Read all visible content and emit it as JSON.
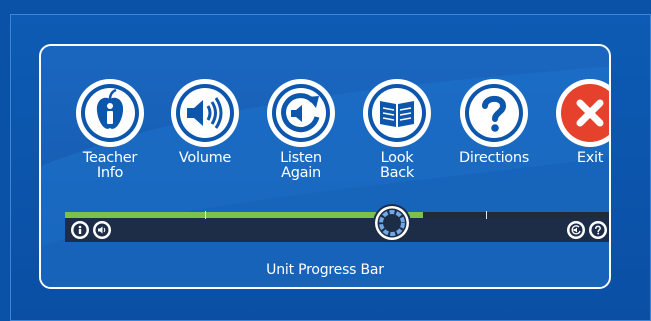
{
  "toolbar": {
    "buttons": [
      {
        "label": "Teacher\nInfo",
        "icon": "teacher-info-icon"
      },
      {
        "label": "Volume",
        "icon": "volume-icon"
      },
      {
        "label": "Listen\nAgain",
        "icon": "listen-again-icon"
      },
      {
        "label": "Look\nBack",
        "icon": "look-back-icon"
      },
      {
        "label": "Directions",
        "icon": "directions-icon"
      },
      {
        "label": "Exit",
        "icon": "exit-icon"
      }
    ]
  },
  "progress_bar": {
    "label": "Unit Progress Bar",
    "progress_fraction": 0.635,
    "tick_marks": 2
  },
  "colors": {
    "background": "#0a52a8",
    "panel": "#1a66bf",
    "progress_fill": "#7ec04a",
    "track": "#1d2d47",
    "exit_red": "#e5412c",
    "icon_blue": "#0c56ac"
  }
}
